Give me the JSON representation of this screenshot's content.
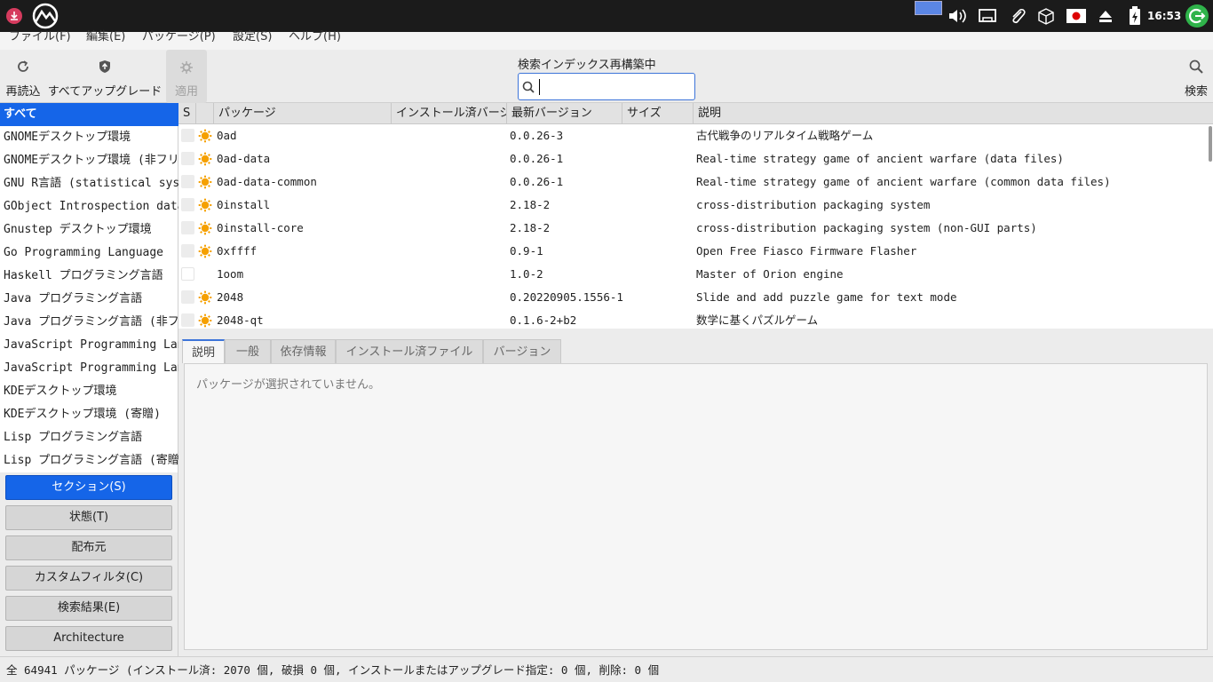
{
  "panel": {
    "clock": "16:53"
  },
  "menu": {
    "items": [
      "ファイル(F)",
      "編集(E)",
      "パッケージ(P)",
      "設定(S)",
      "ヘルプ(H)"
    ]
  },
  "toolbar": {
    "reload_label": "再読込",
    "upgrade_all_label": "すべてアップグレード",
    "apply_label": "適用",
    "search_title": "検索インデックス再構築中",
    "search_value": "",
    "search_button_label": "検索"
  },
  "sections": [
    "すべて",
    "GNOMEデスクトップ環境",
    "GNOMEデスクトップ環境 (非フリー)",
    "GNU R言語 (statistical system)",
    "GObject Introspection data",
    "Gnustep デスクトップ環境",
    "Go Programming Language",
    "Haskell プログラミング言語",
    "Java プログラミング言語",
    "Java プログラミング言語 (非フリー)",
    "JavaScript Programming Language",
    "JavaScript Programming Language",
    "KDEデスクトップ環境",
    "KDEデスクトップ環境 (寄贈)",
    "Lisp プログラミング言語",
    "Lisp プログラミング言語 (寄贈)"
  ],
  "filters": {
    "sections": "セクション(S)",
    "status": "状態(T)",
    "origin": "配布元",
    "custom": "カスタムフィルタ(C)",
    "search_results": "検索結果(E)",
    "architecture": "Architecture"
  },
  "table": {
    "headers": {
      "s": "S",
      "package": "パッケージ",
      "installed": "インストール済バージョン",
      "latest": "最新バージョン",
      "size": "サイズ",
      "description": "説明"
    },
    "rows": [
      {
        "package": "0ad",
        "latest": "0.0.26-3",
        "description": "古代戦争のリアルタイム戦略ゲーム",
        "supported": true
      },
      {
        "package": "0ad-data",
        "latest": "0.0.26-1",
        "description": "Real-time strategy game of ancient warfare (data files)",
        "supported": true
      },
      {
        "package": "0ad-data-common",
        "latest": "0.0.26-1",
        "description": "Real-time strategy game of ancient warfare (common data files)",
        "supported": true
      },
      {
        "package": "0install",
        "latest": "2.18-2",
        "description": "cross-distribution packaging system",
        "supported": true
      },
      {
        "package": "0install-core",
        "latest": "2.18-2",
        "description": "cross-distribution packaging system (non-GUI parts)",
        "supported": true
      },
      {
        "package": "0xffff",
        "latest": "0.9-1",
        "description": "Open Free Fiasco Firmware Flasher",
        "supported": true
      },
      {
        "package": "1oom",
        "latest": "1.0-2",
        "description": "Master of Orion engine",
        "supported": false
      },
      {
        "package": "2048",
        "latest": "0.20220905.1556-1",
        "description": "Slide and add puzzle game for text mode",
        "supported": true
      },
      {
        "package": "2048-qt",
        "latest": "0.1.6-2+b2",
        "description": "数学に基くパズルゲーム",
        "supported": true
      }
    ]
  },
  "details": {
    "tabs": [
      "説明",
      "一般",
      "依存情報",
      "インストール済ファイル",
      "バージョン"
    ],
    "message": "パッケージが選択されていません。"
  },
  "status": "全 64941 パッケージ (インストール済: 2070 個, 破損 0 個, インストールまたはアップグレード指定: 0 個, 削除: 0 個"
}
